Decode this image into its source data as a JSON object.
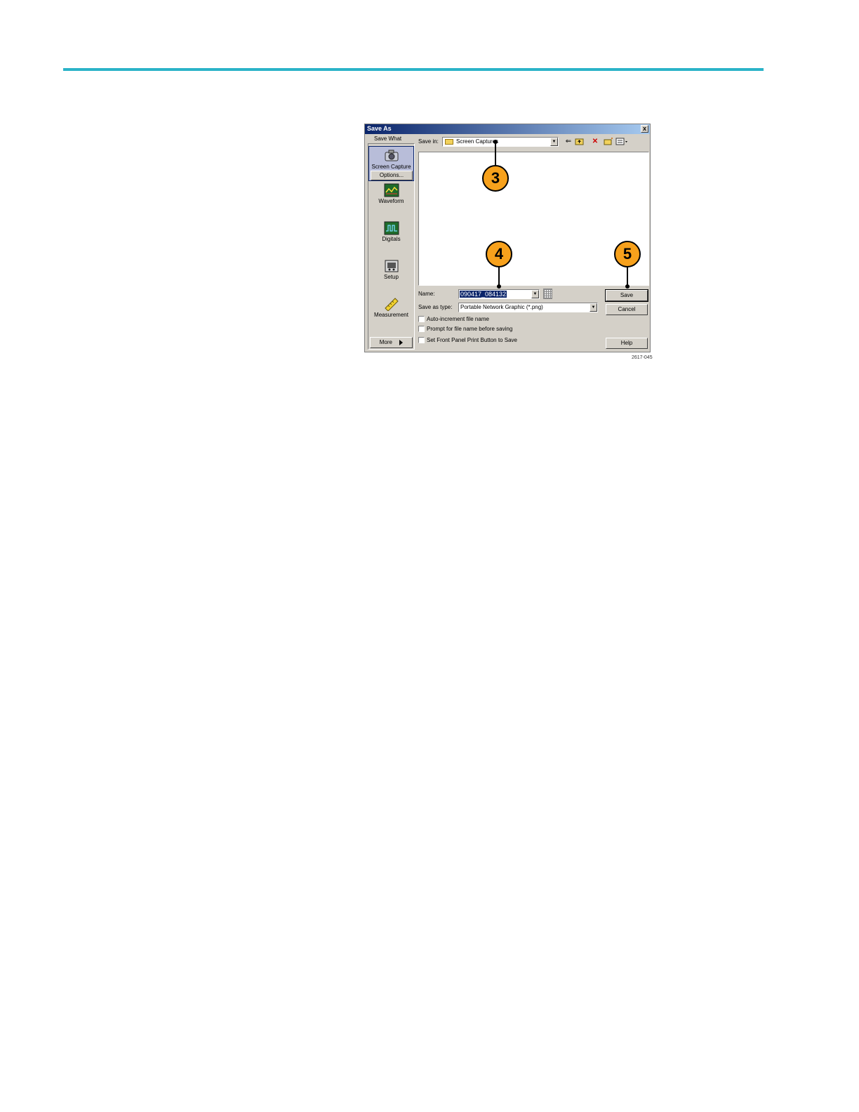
{
  "dialog": {
    "title": "Save As",
    "close_glyph": "x",
    "save_what_label": "Save What",
    "categories": [
      {
        "label": "Screen Capture",
        "icon": "camera-icon",
        "selected": true
      },
      {
        "label": "Waveform",
        "icon": "waveform-icon",
        "selected": false
      },
      {
        "label": "Digitals",
        "icon": "digitals-icon",
        "selected": false
      },
      {
        "label": "Setup",
        "icon": "setup-icon",
        "selected": false
      },
      {
        "label": "Measurement",
        "icon": "ruler-icon",
        "selected": false
      }
    ],
    "options_label": "Options...",
    "more_label": "More",
    "save_in_label": "Save in:",
    "save_in_value": "Screen Captures",
    "name_label": "Name:",
    "name_value": "090417_084132",
    "save_type_label": "Save as type:",
    "save_type_value": "Portable Network Graphic (*.png)",
    "checkboxes": [
      {
        "label": "Auto-increment file name",
        "checked": false
      },
      {
        "label": "Prompt for file name before saving",
        "checked": false
      },
      {
        "label": "Set Front Panel Print Button to Save",
        "checked": false
      }
    ],
    "buttons": {
      "save": "Save",
      "cancel": "Cancel",
      "help": "Help"
    }
  },
  "callouts": [
    "3",
    "4",
    "5"
  ],
  "figure_code": "2617-045",
  "colors": {
    "accent_rule": "#2bb3c8",
    "callout": "#f7a11c",
    "titlebar": "#0a246a"
  }
}
